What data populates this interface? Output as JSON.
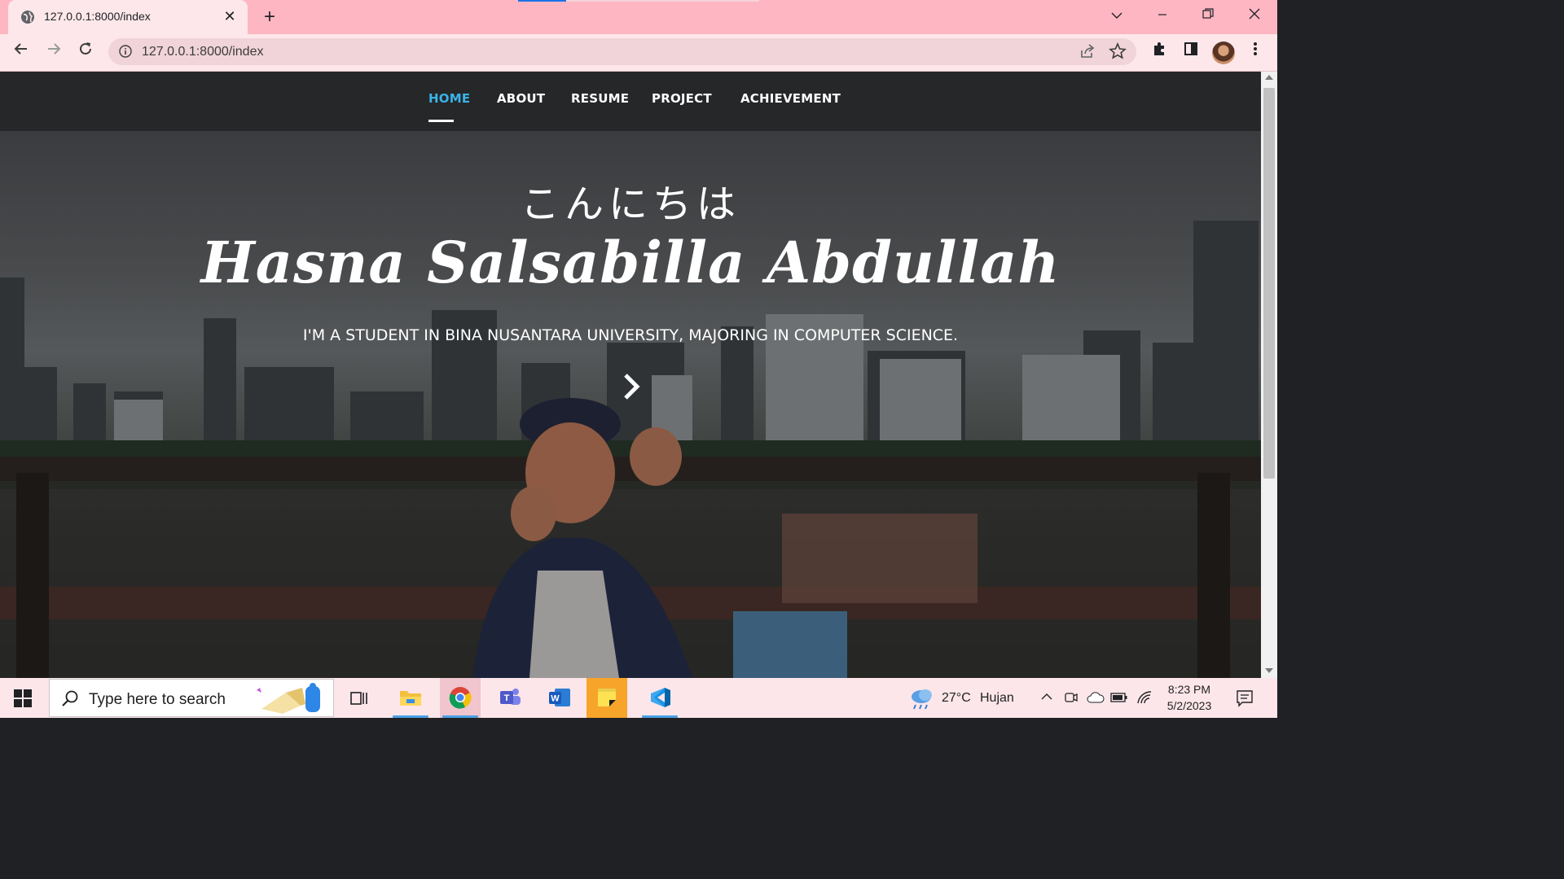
{
  "browser": {
    "tab_title": "127.0.0.1:8000/index",
    "url": "127.0.0.1:8000/index",
    "new_tab_symbol": "+",
    "close_symbol": "✕",
    "window_controls": [
      "chevron-down",
      "minimize",
      "restore",
      "close"
    ],
    "icons": [
      "globe-icon",
      "back-icon",
      "forward-icon",
      "reload-icon",
      "info-icon",
      "share-icon",
      "star-icon",
      "extensions-icon",
      "sidepanel-icon",
      "profile-avatar",
      "menu-icon"
    ]
  },
  "site": {
    "nav": [
      {
        "label": "HOME",
        "active": true
      },
      {
        "label": "ABOUT",
        "active": false
      },
      {
        "label": "RESUME",
        "active": false
      },
      {
        "label": "PROJECT",
        "active": false
      },
      {
        "label": "ACHIEVEMENT",
        "active": false
      }
    ],
    "accent": "#3bb3e8",
    "nav_bg": "#262729",
    "hero": {
      "greeting": "こんにちは",
      "name": "Hasna Salsabilla Abdullah",
      "tagline": "I'M A STUDENT IN BINA NUSANTARA UNIVERSITY, MAJORING IN COMPUTER SCIENCE."
    }
  },
  "taskbar": {
    "search_placeholder": "Type here to search",
    "apps": [
      "task-view",
      "file-explorer",
      "chrome",
      "teams",
      "word",
      "sticky-notes",
      "vscode"
    ],
    "weather": {
      "temp": "27°C",
      "condition": "Hujan"
    },
    "time": "8:23 PM",
    "date": "5/2/2023"
  }
}
